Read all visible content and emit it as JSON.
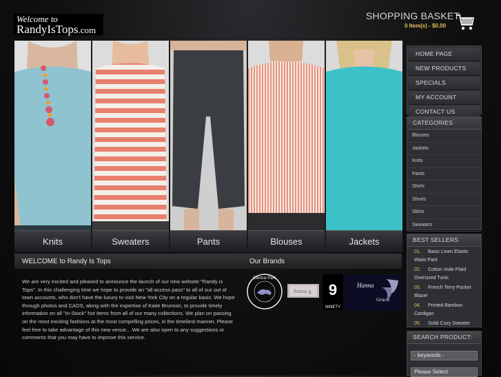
{
  "header": {
    "logo_line1": "Welcome to",
    "logo_line2": "RandyIsTops",
    "logo_tld": ".com",
    "basket_title": "SHOPPING BASKET:",
    "basket_summary": "0 Item(s) - $0.00",
    "cart_icon": "shopping-cart-icon"
  },
  "hero": {
    "categories": [
      {
        "label": "Knits",
        "color": "#8fc3cf"
      },
      {
        "label": "Sweaters",
        "color": "#e88a7a"
      },
      {
        "label": "Pants",
        "color": "#3a3d42"
      },
      {
        "label": "Blouses",
        "color": "#efb5a4"
      },
      {
        "label": "Jackets",
        "color": "#3cc1c8"
      }
    ]
  },
  "nav": {
    "items": [
      "HOME PAGE",
      "NEW PRODUCTS",
      "SPECIALS",
      "MY ACCOUNT",
      "CONTACT US"
    ]
  },
  "categories": {
    "title": "CATEGORIES",
    "items": [
      "Blouses",
      "Jackets",
      "Knits",
      "Pants",
      "Shirts",
      "Shorts",
      "Skirts",
      "Sweaters"
    ]
  },
  "best_sellers": {
    "title": "BEST SELLERS",
    "items": [
      {
        "num": "01.",
        "name": "Basic Linen Elastic Waist Pant"
      },
      {
        "num": "02.",
        "name": "Cotton Voile Plaid Oversized Tunic"
      },
      {
        "num": "03.",
        "name": "French Terry Pocket Blazer"
      },
      {
        "num": "04.",
        "name": "Printed Bamboo Cardigan"
      },
      {
        "num": "05.",
        "name": "Solid Cozy Sweater"
      }
    ]
  },
  "search": {
    "title": "SEARCH PRODUCT:",
    "keywords_placeholder": "- keywords -",
    "select_value": "Please Select"
  },
  "welcome": {
    "title": "WELCOME to Randy Is Tops",
    "text": "We are very excited and pleased to announce the launch of our new website \"Randy is Tops\". In this challenging time we hope to provide an \"all access pass\" to all of our out of town accounts, who don't have the luxury to visit New York City on a regular basis. We hope through photos and CADS, along with the expertise of Katie Brunson, to provide timely information on all \"In-Stock\" hot items from all of our many collections. We plan on passing on the most exciting fashions at the most compelling prices, in the timeliest manner. Please feel free to take advantage of this new venue... We are also open to any suggestions or comments that you may have to improve this service."
  },
  "brands": {
    "title": "Our Brands",
    "logos": [
      {
        "name": "Central Park",
        "sub": "Central Park"
      },
      {
        "name": "hanna g.",
        "sub": "hanna g."
      },
      {
        "name": "NINETY",
        "sub": "NINETY"
      },
      {
        "name": "Hanna Gracie",
        "sub": "Gracie"
      }
    ]
  }
}
